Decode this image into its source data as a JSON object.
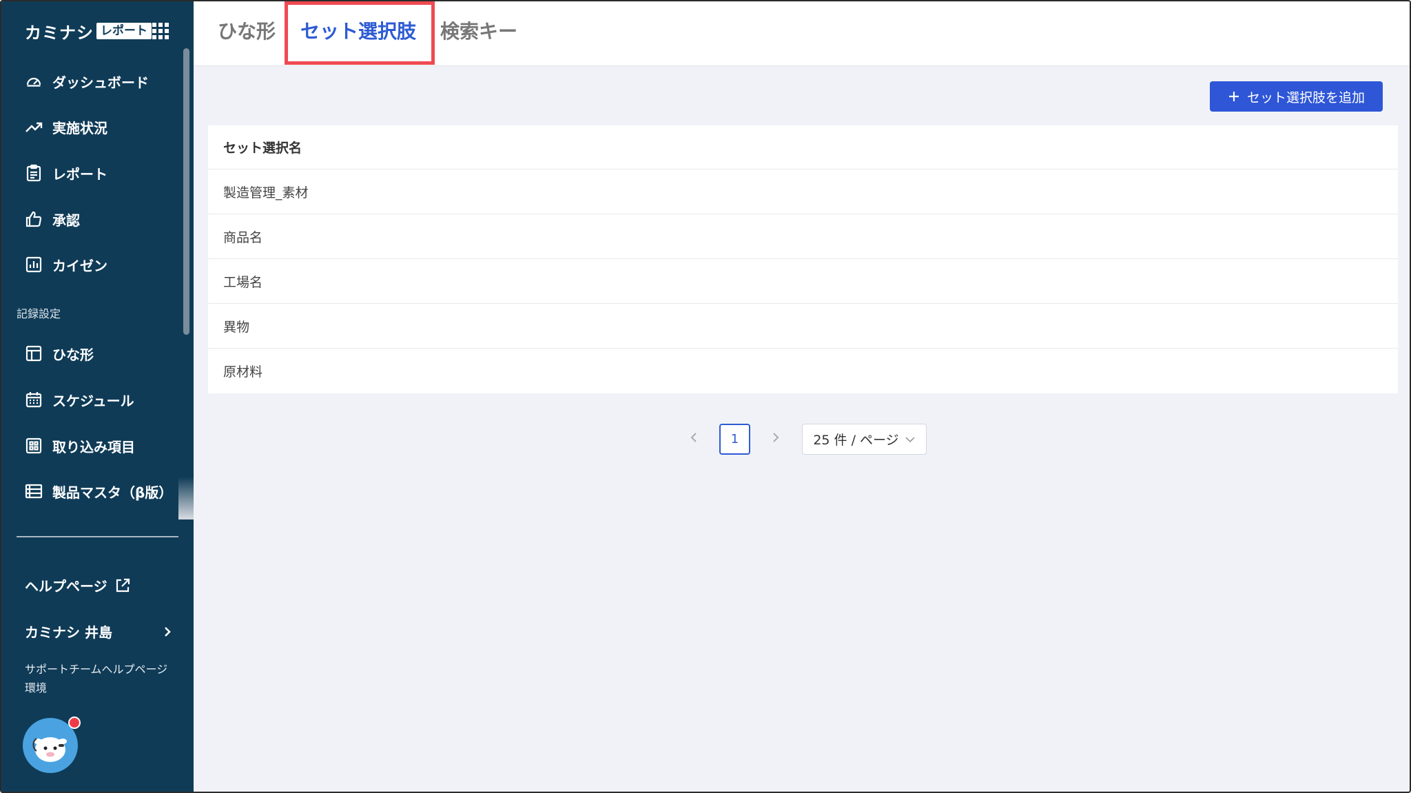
{
  "sidebar": {
    "brand_name": "カミナシ",
    "brand_tag": "レポート",
    "items": [
      {
        "label": "ダッシュボード",
        "icon": "gauge-icon"
      },
      {
        "label": "実施状況",
        "icon": "trend-up-icon"
      },
      {
        "label": "レポート",
        "icon": "clipboard-icon"
      },
      {
        "label": "承認",
        "icon": "thumbs-up-icon"
      },
      {
        "label": "カイゼン",
        "icon": "bar-chart-icon"
      }
    ],
    "section_label": "記録設定",
    "settings_items": [
      {
        "label": "ひな形",
        "icon": "template-icon"
      },
      {
        "label": "スケジュール",
        "icon": "calendar-icon"
      },
      {
        "label": "取り込み項目",
        "icon": "grid-icon"
      },
      {
        "label": "製品マスタ（β版）",
        "icon": "list-icon"
      }
    ],
    "help_label": "ヘルプページ",
    "user_name": "カミナシ 井島",
    "environment_text": "サポートチームヘルプページ環境"
  },
  "tabs": [
    {
      "label": "ひな形",
      "active": false
    },
    {
      "label": "セット選択肢",
      "active": true
    },
    {
      "label": "検索キー",
      "active": false
    }
  ],
  "toolbar": {
    "add_label": "セット選択肢を追加"
  },
  "table": {
    "header": "セット選択名",
    "rows": [
      "製造管理_素材",
      "商品名",
      "工場名",
      "異物",
      "原材料"
    ]
  },
  "pagination": {
    "current_page": "1",
    "page_size_label": "25 件 / ページ"
  },
  "colors": {
    "sidebar_bg": "#0f3b57",
    "accent": "#2e56d6",
    "highlight": "#ef4a52"
  }
}
